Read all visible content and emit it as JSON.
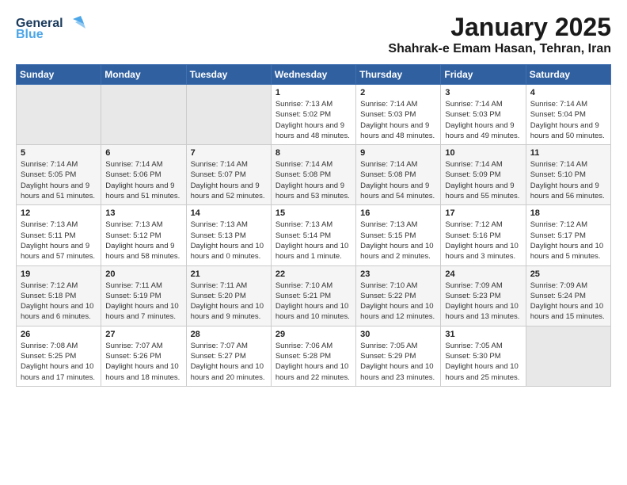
{
  "header": {
    "logo_general": "General",
    "logo_blue": "Blue",
    "month": "January 2025",
    "location": "Shahrak-e Emam Hasan, Tehran, Iran"
  },
  "weekdays": [
    "Sunday",
    "Monday",
    "Tuesday",
    "Wednesday",
    "Thursday",
    "Friday",
    "Saturday"
  ],
  "weeks": [
    [
      {
        "day": "",
        "empty": true
      },
      {
        "day": "",
        "empty": true
      },
      {
        "day": "",
        "empty": true
      },
      {
        "day": "1",
        "sunrise": "7:13 AM",
        "sunset": "5:02 PM",
        "daylight": "9 hours and 48 minutes."
      },
      {
        "day": "2",
        "sunrise": "7:14 AM",
        "sunset": "5:03 PM",
        "daylight": "9 hours and 48 minutes."
      },
      {
        "day": "3",
        "sunrise": "7:14 AM",
        "sunset": "5:03 PM",
        "daylight": "9 hours and 49 minutes."
      },
      {
        "day": "4",
        "sunrise": "7:14 AM",
        "sunset": "5:04 PM",
        "daylight": "9 hours and 50 minutes."
      }
    ],
    [
      {
        "day": "5",
        "sunrise": "7:14 AM",
        "sunset": "5:05 PM",
        "daylight": "9 hours and 51 minutes."
      },
      {
        "day": "6",
        "sunrise": "7:14 AM",
        "sunset": "5:06 PM",
        "daylight": "9 hours and 51 minutes."
      },
      {
        "day": "7",
        "sunrise": "7:14 AM",
        "sunset": "5:07 PM",
        "daylight": "9 hours and 52 minutes."
      },
      {
        "day": "8",
        "sunrise": "7:14 AM",
        "sunset": "5:08 PM",
        "daylight": "9 hours and 53 minutes."
      },
      {
        "day": "9",
        "sunrise": "7:14 AM",
        "sunset": "5:08 PM",
        "daylight": "9 hours and 54 minutes."
      },
      {
        "day": "10",
        "sunrise": "7:14 AM",
        "sunset": "5:09 PM",
        "daylight": "9 hours and 55 minutes."
      },
      {
        "day": "11",
        "sunrise": "7:14 AM",
        "sunset": "5:10 PM",
        "daylight": "9 hours and 56 minutes."
      }
    ],
    [
      {
        "day": "12",
        "sunrise": "7:13 AM",
        "sunset": "5:11 PM",
        "daylight": "9 hours and 57 minutes."
      },
      {
        "day": "13",
        "sunrise": "7:13 AM",
        "sunset": "5:12 PM",
        "daylight": "9 hours and 58 minutes."
      },
      {
        "day": "14",
        "sunrise": "7:13 AM",
        "sunset": "5:13 PM",
        "daylight": "10 hours and 0 minutes."
      },
      {
        "day": "15",
        "sunrise": "7:13 AM",
        "sunset": "5:14 PM",
        "daylight": "10 hours and 1 minute."
      },
      {
        "day": "16",
        "sunrise": "7:13 AM",
        "sunset": "5:15 PM",
        "daylight": "10 hours and 2 minutes."
      },
      {
        "day": "17",
        "sunrise": "7:12 AM",
        "sunset": "5:16 PM",
        "daylight": "10 hours and 3 minutes."
      },
      {
        "day": "18",
        "sunrise": "7:12 AM",
        "sunset": "5:17 PM",
        "daylight": "10 hours and 5 minutes."
      }
    ],
    [
      {
        "day": "19",
        "sunrise": "7:12 AM",
        "sunset": "5:18 PM",
        "daylight": "10 hours and 6 minutes."
      },
      {
        "day": "20",
        "sunrise": "7:11 AM",
        "sunset": "5:19 PM",
        "daylight": "10 hours and 7 minutes."
      },
      {
        "day": "21",
        "sunrise": "7:11 AM",
        "sunset": "5:20 PM",
        "daylight": "10 hours and 9 minutes."
      },
      {
        "day": "22",
        "sunrise": "7:10 AM",
        "sunset": "5:21 PM",
        "daylight": "10 hours and 10 minutes."
      },
      {
        "day": "23",
        "sunrise": "7:10 AM",
        "sunset": "5:22 PM",
        "daylight": "10 hours and 12 minutes."
      },
      {
        "day": "24",
        "sunrise": "7:09 AM",
        "sunset": "5:23 PM",
        "daylight": "10 hours and 13 minutes."
      },
      {
        "day": "25",
        "sunrise": "7:09 AM",
        "sunset": "5:24 PM",
        "daylight": "10 hours and 15 minutes."
      }
    ],
    [
      {
        "day": "26",
        "sunrise": "7:08 AM",
        "sunset": "5:25 PM",
        "daylight": "10 hours and 17 minutes."
      },
      {
        "day": "27",
        "sunrise": "7:07 AM",
        "sunset": "5:26 PM",
        "daylight": "10 hours and 18 minutes."
      },
      {
        "day": "28",
        "sunrise": "7:07 AM",
        "sunset": "5:27 PM",
        "daylight": "10 hours and 20 minutes."
      },
      {
        "day": "29",
        "sunrise": "7:06 AM",
        "sunset": "5:28 PM",
        "daylight": "10 hours and 22 minutes."
      },
      {
        "day": "30",
        "sunrise": "7:05 AM",
        "sunset": "5:29 PM",
        "daylight": "10 hours and 23 minutes."
      },
      {
        "day": "31",
        "sunrise": "7:05 AM",
        "sunset": "5:30 PM",
        "daylight": "10 hours and 25 minutes."
      },
      {
        "day": "",
        "empty": true
      }
    ]
  ]
}
